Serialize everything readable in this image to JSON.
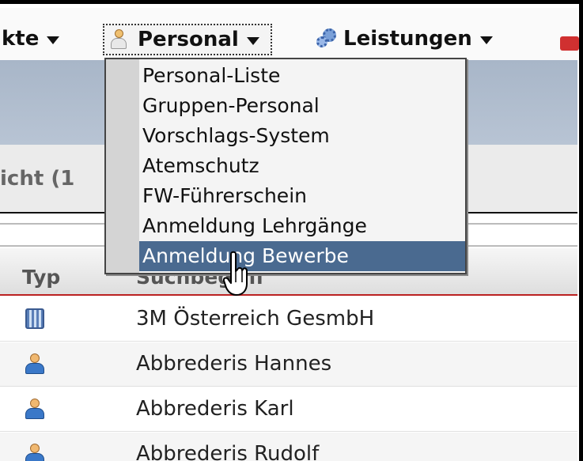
{
  "menubar": {
    "items": [
      {
        "label": "kte",
        "icon": "none"
      },
      {
        "label": "Personal",
        "icon": "person-icon"
      },
      {
        "label": "Leistungen",
        "icon": "gears-icon"
      }
    ]
  },
  "overview": {
    "label": "icht (1"
  },
  "dropdown": {
    "items": [
      "Personal-Liste",
      "Gruppen-Personal",
      "Vorschlags-System",
      "Atemschutz",
      "FW-Führerschein",
      "Anmeldung Lehrgänge",
      "Anmeldung Bewerbe"
    ],
    "selected_index": 6
  },
  "table": {
    "columns": {
      "typ": "Typ",
      "name": "Suchbegriff"
    },
    "rows": [
      {
        "type": "company",
        "name": "3M Österreich GesmbH"
      },
      {
        "type": "person",
        "name": "Abbrederis Hannes"
      },
      {
        "type": "person",
        "name": "Abbrederis Karl"
      },
      {
        "type": "person",
        "name": "Abbrederis Rudolf"
      }
    ]
  },
  "colors": {
    "band": "#b0bdce",
    "selected": "#4a6a90",
    "header_line": "#bb2222"
  }
}
